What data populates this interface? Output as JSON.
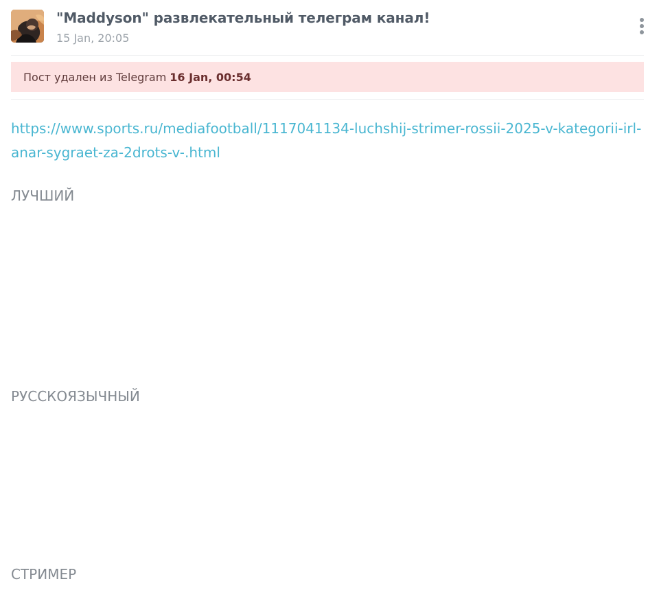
{
  "post": {
    "channel_title": "\"Maddyson\" развлекательный телеграм канал!",
    "time": "15 Jan, 20:05",
    "alert": {
      "prefix": "Пост удален из Telegram",
      "deleted_time": "16 Jan, 00:54"
    },
    "link": "https://www.sports.ru/mediafootball/1117041134-luchshij-strimer-rossii-2025-v-kategorii-irl-anar-sygraet-za-2drots-v-.html",
    "words": [
      "ЛУЧШИЙ",
      "РУССКОЯЗЫЧНЫЙ",
      "СТРИМЕР"
    ]
  },
  "icons": {
    "avatar": "channel-avatar",
    "menu": "vertical-ellipsis-icon"
  },
  "colors": {
    "accent_link": "#49b6d1",
    "alert_background": "#fde2e2",
    "title_text": "#505a66",
    "muted_text": "#9aa1a8",
    "body_text": "#848a91"
  }
}
